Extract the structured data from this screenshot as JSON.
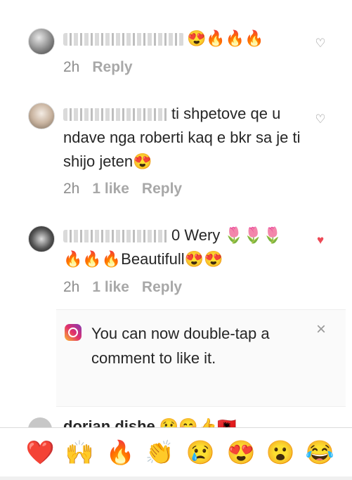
{
  "comments": [
    {
      "text": "😍🔥🔥🔥",
      "time": "2h",
      "likes": "",
      "reply": "Reply",
      "liked": false
    },
    {
      "text": "ti shpetove qe u ndave nga roberti kaq e bkr sa je ti shijo jeten😍",
      "time": "2h",
      "likes": "1 like",
      "reply": "Reply",
      "liked": false
    },
    {
      "text": "0 Wery 🌷🌷🌷 🔥🔥🔥Beautifull😍😍",
      "time": "2h",
      "likes": "1 like",
      "reply": "Reply",
      "liked": true
    }
  ],
  "tip": {
    "text": "You can now double-tap a comment to like it.",
    "close": "×"
  },
  "partial_comment": {
    "username": "dorian dishe",
    "text": "😢😊👍🇦🇱"
  },
  "emoji_bar": [
    "❤️",
    "🙌",
    "🔥",
    "👏",
    "😢",
    "😍",
    "😮",
    "😂"
  ],
  "colors": {
    "like_red": "#ed4956",
    "meta_gray": "#a8a8a8",
    "text": "#262626"
  }
}
